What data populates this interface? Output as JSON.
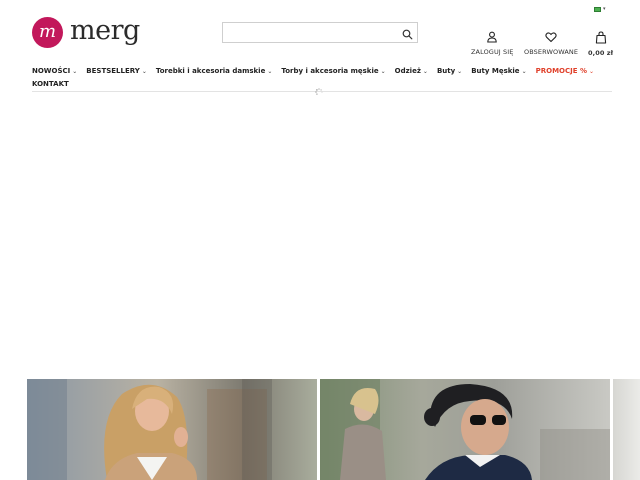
{
  "header": {
    "logo": {
      "mark_letter": "m",
      "brand_name": "merg",
      "brand_color": "#c2185b"
    },
    "language": {
      "flag_icon": "flag-icon",
      "chevron_icon": "chevron-down-icon"
    },
    "search": {
      "placeholder": "",
      "value": "",
      "button_icon": "search-icon"
    },
    "account": {
      "label": "ZALOGUJ SIĘ",
      "icon": "user-icon"
    },
    "wishlist": {
      "label": "OBSERWOWANE",
      "icon": "heart-icon"
    },
    "cart": {
      "label": "0,00 zł",
      "icon": "shopping-bag-icon"
    }
  },
  "nav": {
    "items": [
      {
        "label": "NOWOŚCI",
        "has_dropdown": true
      },
      {
        "label": "BESTSELLERY",
        "has_dropdown": true
      },
      {
        "label": "Torebki i akcesoria damskie",
        "has_dropdown": true
      },
      {
        "label": "Torby i akcesoria męskie",
        "has_dropdown": true
      },
      {
        "label": "Odzież",
        "has_dropdown": true
      },
      {
        "label": "Buty",
        "has_dropdown": true
      },
      {
        "label": "Buty Męskie",
        "has_dropdown": true
      },
      {
        "label": "PROMOCJE %",
        "has_dropdown": true,
        "color": "#e0412b"
      },
      {
        "label": "KONTAKT",
        "has_dropdown": false
      }
    ],
    "chevron": "⌄"
  },
  "main": {
    "loading_icon": "loading-spinner-icon",
    "banners": [
      {
        "name": "banner-woman-beige-blazer"
      },
      {
        "name": "banner-woman-sunglasses-navy"
      },
      {
        "name": "banner-partial-third"
      }
    ]
  }
}
